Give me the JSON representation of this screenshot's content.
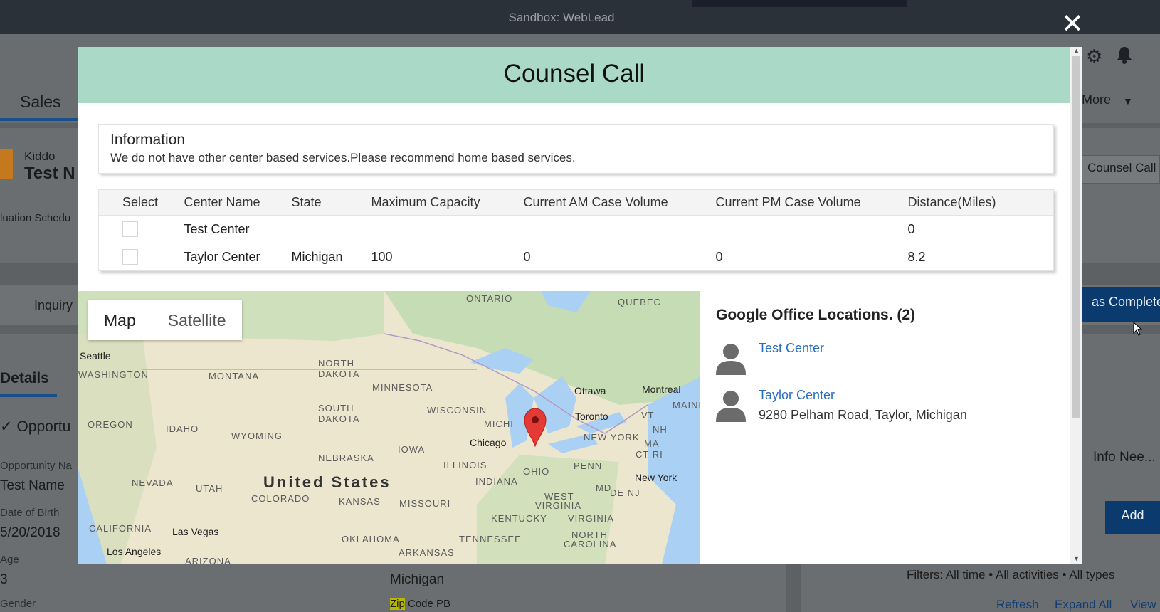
{
  "window": {
    "title": "Sandbox: WebLead",
    "close_glyph": "✕"
  },
  "background": {
    "app_name": "Sales",
    "more_label": "More",
    "record_type": "Kiddo",
    "record_name": "Test N",
    "evaluation_label": "luation Schedu",
    "counsel_call_button": "Counsel Call",
    "inquiry_label": "Inquiry",
    "mark_complete_button": "as Complete",
    "details_tab": "Details",
    "paren": ")",
    "section_label": "Opportu",
    "info_needed": "Info Nee...",
    "add_button": "Add",
    "fields": [
      {
        "label": "Opportunity Na",
        "value": "Test Name"
      },
      {
        "label": "Date of Birth",
        "value": "5/20/2018"
      },
      {
        "label": "Age",
        "value": "3"
      },
      {
        "label": "Gender",
        "value": ""
      }
    ],
    "state_value": "Michigan",
    "zip_label_highlight": "Zip",
    "zip_label_rest": " Code PB",
    "filters_text": "Filters: All time • All activities • All types",
    "actions": {
      "refresh": "Refresh",
      "expand_all": "Expand All",
      "view": "View"
    }
  },
  "modal": {
    "title": "Counsel Call",
    "information": {
      "heading": "Information",
      "message": "We do not have other center based services.Please recommend home based services."
    },
    "table": {
      "columns": [
        "Select",
        "Center Name",
        "State",
        "Maximum Capacity",
        "Current AM Case Volume",
        "Current PM Case Volume",
        "Distance(Miles)"
      ],
      "rows": [
        {
          "center": "Test Center",
          "state": "",
          "max_capacity": "",
          "am_volume": "",
          "pm_volume": "",
          "distance": "0"
        },
        {
          "center": "Taylor Center",
          "state": "Michigan",
          "max_capacity": "100",
          "am_volume": "0",
          "pm_volume": "0",
          "distance": "8.2"
        }
      ]
    },
    "map": {
      "tabs": [
        "Map",
        "Satellite"
      ],
      "labels": {
        "ontario": "ONTARIO",
        "quebec": "QUEBEC",
        "seattle": "Seattle",
        "washington": "WASHINGTON",
        "montana": "MONTANA",
        "north_dakota_1": "NORTH",
        "north_dakota_2": "DAKOTA",
        "minnesota": "MINNESOTA",
        "ottawa": "Ottawa",
        "montreal": "Montreal",
        "maine": "MAINE",
        "oregon": "OREGON",
        "idaho": "IDAHO",
        "south_dakota_1": "SOUTH",
        "south_dakota_2": "DAKOTA",
        "wisconsin": "WISCONSIN",
        "michigan": "MICHI",
        "toronto": "Toronto",
        "vt": "VT",
        "nh": "NH",
        "wyoming": "WYOMING",
        "new_york_state": "NEW YORK",
        "ma": "MA",
        "ct_ri": "CT RI",
        "chicago": "Chicago",
        "iowa": "IOWA",
        "nebraska": "NEBRASKA",
        "illinois": "ILLINOIS",
        "penn": "PENN",
        "nevada": "NEVADA",
        "utah": "UTAH",
        "united_states": "United States",
        "indiana": "INDIANA",
        "ohio": "OHIO",
        "new_york_city": "New York",
        "colorado": "COLORADO",
        "kansas": "KANSAS",
        "missouri": "MISSOURI",
        "md": "MD",
        "de_nj": "DE NJ",
        "west_virginia_1": "WEST",
        "west_virginia_2": "VIRGINIA",
        "virginia": "VIRGINIA",
        "kentucky": "KENTUCKY",
        "california": "CALIFORNIA",
        "las_vegas": "Las Vegas",
        "oklahoma": "OKLAHOMA",
        "tennessee": "TENNESSEE",
        "north_carolina_1": "NORTH",
        "north_carolina_2": "CAROLINA",
        "arkansas": "ARKANSAS",
        "los_angeles": "Los Angeles",
        "arizona": "ARIZONA"
      }
    },
    "locations": {
      "heading": "Google Office Locations. (2)",
      "items": [
        {
          "name": "Test Center",
          "address": ""
        },
        {
          "name": "Taylor Center",
          "address": "9280 Pelham Road, Taylor, Michigan"
        }
      ]
    }
  },
  "colors": {
    "header_bg": "#abd9c8",
    "link": "#2a6ebb",
    "distance": "#d2131d",
    "pin": "#e53935"
  }
}
